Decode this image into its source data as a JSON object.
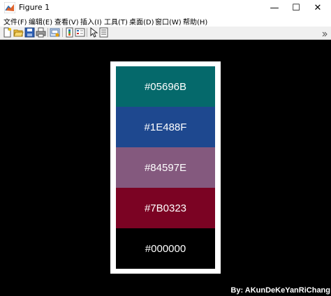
{
  "window": {
    "title": "Figure 1",
    "minimize_glyph": "—",
    "maximize_glyph": "☐",
    "close_glyph": "✕"
  },
  "menu": {
    "items": [
      {
        "label": "文件(F)"
      },
      {
        "label": "编辑(E)"
      },
      {
        "label": "查看(V)"
      },
      {
        "label": "插入(I)"
      },
      {
        "label": "工具(T)"
      },
      {
        "label": "桌面(D)"
      },
      {
        "label": "窗口(W)"
      },
      {
        "label": "帮助(H)"
      }
    ]
  },
  "toolbar": {
    "icons": [
      "new-figure-icon",
      "open-icon",
      "save-icon",
      "print-icon",
      "link-plot-icon",
      "insert-colorbar-icon",
      "insert-legend-icon",
      "edit-plot-pointer-icon",
      "property-inspector-icon"
    ]
  },
  "palette": {
    "swatches": [
      {
        "label": "#05696B",
        "color": "#05696B"
      },
      {
        "label": "#1E488F",
        "color": "#1E488F"
      },
      {
        "label": "#84597E",
        "color": "#84597E"
      },
      {
        "label": "#7B0323",
        "color": "#7B0323"
      },
      {
        "label": "#000000",
        "color": "#000000"
      }
    ]
  },
  "credit": "By: AKunDeKeYanRiChang",
  "colors": {
    "figure_background": "#000000",
    "palette_frame": "#FFFFFF",
    "swatch_text": "#FFFFFF"
  }
}
